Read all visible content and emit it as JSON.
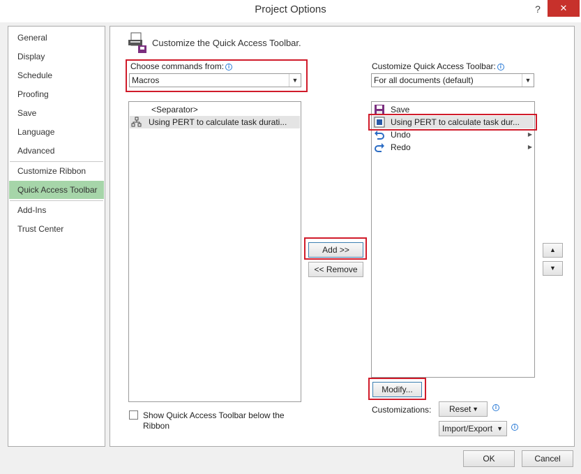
{
  "window": {
    "title": "Project Options",
    "help_glyph": "?",
    "close_glyph": "✕"
  },
  "nav": {
    "items": [
      {
        "label": "General"
      },
      {
        "label": "Display"
      },
      {
        "label": "Schedule"
      },
      {
        "label": "Proofing"
      },
      {
        "label": "Save"
      },
      {
        "label": "Language"
      },
      {
        "label": "Advanced"
      },
      {
        "label": "Customize Ribbon"
      },
      {
        "label": "Quick Access Toolbar"
      },
      {
        "label": "Add-Ins"
      },
      {
        "label": "Trust Center"
      }
    ],
    "selected": "Quick Access Toolbar"
  },
  "header": {
    "text": "Customize the Quick Access Toolbar."
  },
  "left": {
    "choose_label": "Choose commands from:",
    "choose_value": "Macros",
    "list": [
      {
        "label": "<Separator>"
      },
      {
        "label": "Using PERT to calculate task durati..."
      }
    ]
  },
  "right": {
    "customize_label": "Customize Quick Access Toolbar:",
    "customize_value": "For all documents (default)",
    "list": [
      {
        "label": "Save"
      },
      {
        "label": "Using PERT to calculate task dur..."
      },
      {
        "label": "Undo"
      },
      {
        "label": "Redo"
      }
    ],
    "modify_label": "Modify...",
    "customizations_label": "Customizations:",
    "reset_label": "Reset",
    "import_export_label": "Import/Export"
  },
  "middle": {
    "add_label": "Add >>",
    "remove_label": "<< Remove"
  },
  "options": {
    "show_below_label": "Show Quick Access Toolbar below the",
    "show_below_label2": "Ribbon"
  },
  "footer": {
    "ok_label": "OK",
    "cancel_label": "Cancel"
  },
  "colors": {
    "accent_selected": "#a6d5a9",
    "highlight_red": "#d01b2a",
    "close_red": "#c7312b",
    "info_blue": "#2b7bd6"
  }
}
